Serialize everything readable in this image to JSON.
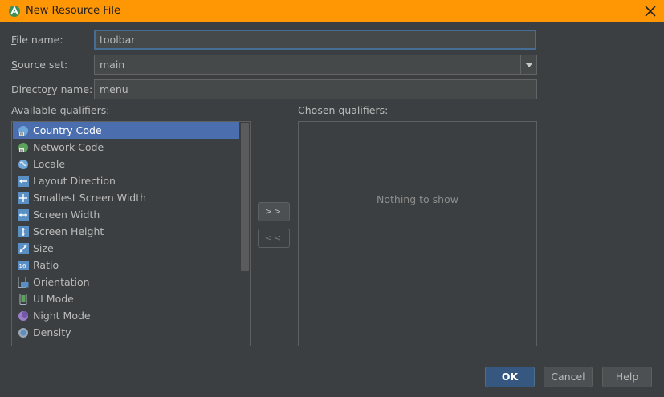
{
  "window": {
    "title": "New Resource File",
    "accent": "#ff9705"
  },
  "form": {
    "file_name": {
      "label": "File name:",
      "mnemonic": "F",
      "label_rest": "ile name:",
      "value": "toolbar"
    },
    "source_set": {
      "label": "Source set:",
      "mnemonic": "S",
      "label_rest": "ource set:",
      "value": "main"
    },
    "directory_name": {
      "label_before": "Directo",
      "mnemonic": "r",
      "label_rest": "y name:",
      "value": "menu"
    }
  },
  "available": {
    "label_before": "A",
    "mnemonic": "v",
    "label_rest": "ailable qualifiers:",
    "items": [
      {
        "label": "Country Code",
        "icon": "country-code-icon",
        "selected": true
      },
      {
        "label": "Network Code",
        "icon": "network-code-icon"
      },
      {
        "label": "Locale",
        "icon": "globe-icon"
      },
      {
        "label": "Layout Direction",
        "icon": "layout-direction-icon"
      },
      {
        "label": "Smallest Screen Width",
        "icon": "smallest-width-icon"
      },
      {
        "label": "Screen Width",
        "icon": "screen-width-icon"
      },
      {
        "label": "Screen Height",
        "icon": "screen-height-icon"
      },
      {
        "label": "Size",
        "icon": "size-icon"
      },
      {
        "label": "Ratio",
        "icon": "ratio-icon"
      },
      {
        "label": "Orientation",
        "icon": "orientation-icon"
      },
      {
        "label": "UI Mode",
        "icon": "ui-mode-icon"
      },
      {
        "label": "Night Mode",
        "icon": "night-mode-icon"
      },
      {
        "label": "Density",
        "icon": "density-icon"
      }
    ]
  },
  "chosen": {
    "label_before": "C",
    "mnemonic": "h",
    "label_rest": "osen qualifiers:",
    "empty_text": "Nothing to show"
  },
  "buttons": {
    "add": ">>",
    "remove": "<<",
    "ok": "OK",
    "cancel": "Cancel",
    "help": "Help"
  }
}
